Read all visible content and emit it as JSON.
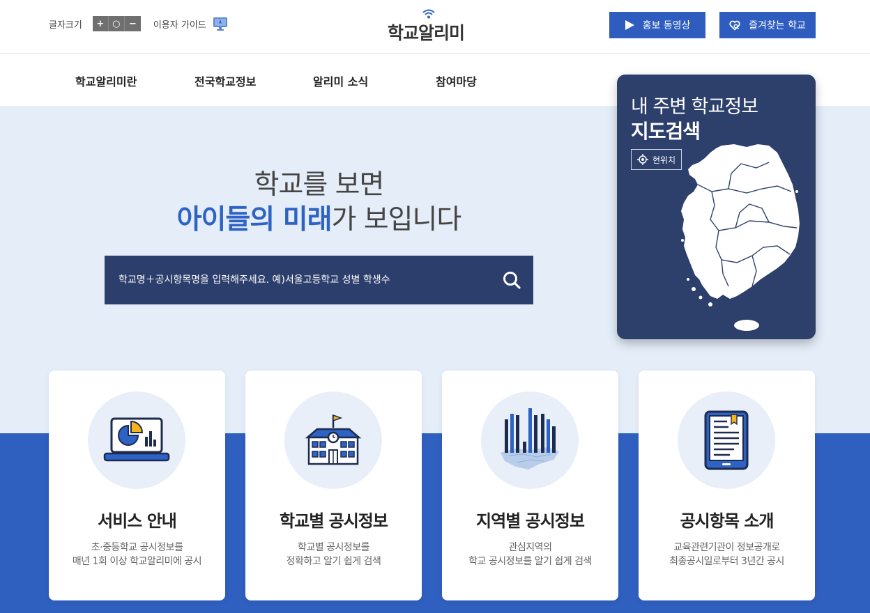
{
  "app": {
    "logo_text": "학교알리미"
  },
  "util": {
    "font_size_label": "글자크기",
    "font_plus": "+",
    "font_reset": "○",
    "font_minus": "−",
    "guide_label": "이용자 가이드"
  },
  "top_buttons": {
    "video_label": "홍보 동영상",
    "favorite_label": "즐겨찾는 학교"
  },
  "gnb": [
    {
      "label": "학교알리미란"
    },
    {
      "label": "전국학교정보"
    },
    {
      "label": "알리미 소식"
    },
    {
      "label": "참여마당"
    }
  ],
  "hero": {
    "slogan_line1": "학교를 보면",
    "slogan_highlight": "아이들의 미래",
    "slogan_rest": "가 보입니다"
  },
  "search": {
    "placeholder": "학교명＋공시항목명을 입력해주세요. 예)서울고등학교 성별 학생수"
  },
  "map_card": {
    "subtitle": "내 주변 학교정보",
    "title": "지도검색",
    "location_button": "현위치"
  },
  "cards": [
    {
      "icon": "laptop-chart-icon",
      "title": "서비스 안내",
      "desc_line1": "초·중등학교 공시정보를",
      "desc_line2": "매년 1회 이상 학교알리미에 공시"
    },
    {
      "icon": "school-building-icon",
      "title": "학교별 공시정보",
      "desc_line1": "학교별 공시정보를",
      "desc_line2": "정확하고 알기 쉽게 검색"
    },
    {
      "icon": "regional-bar-map-icon",
      "title": "지역별 공시정보",
      "desc_line1": "관심지역의",
      "desc_line2": "학교 공시정보를 알기 쉽게 검색"
    },
    {
      "icon": "tablet-document-icon",
      "title": "공시항목 소개",
      "desc_line1": "교육관련기관이 정보공개로",
      "desc_line2": "최종공시일로부터 3년간 공시"
    }
  ],
  "colors": {
    "primary": "#2e5dbf",
    "navy": "#2c3e6b",
    "hero_bg": "#e4edf8",
    "accent_yellow": "#f5b41e"
  }
}
